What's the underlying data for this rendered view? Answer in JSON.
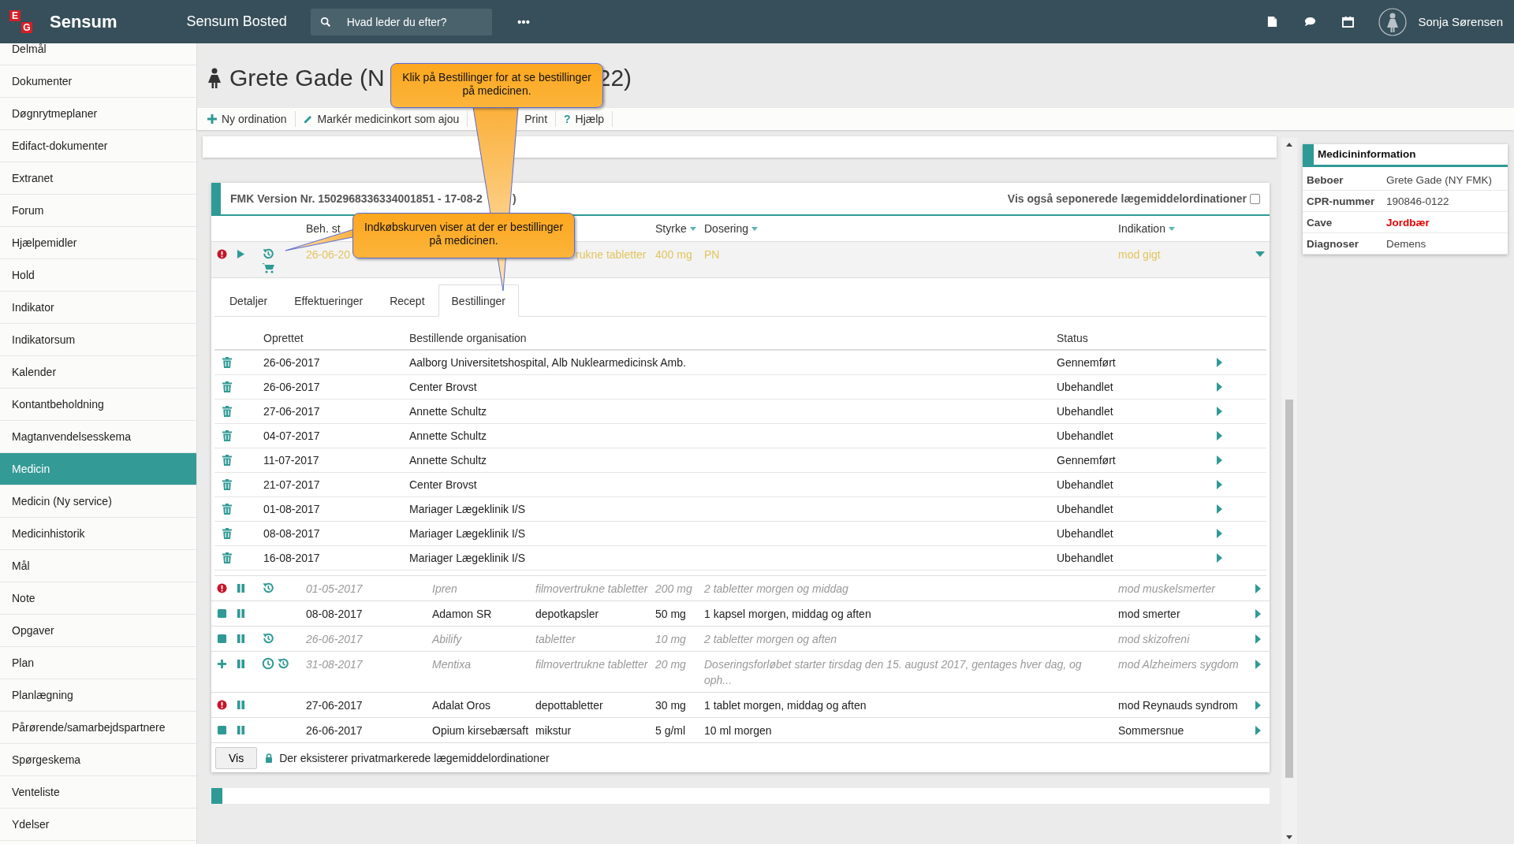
{
  "topbar": {
    "logo_letters": [
      "E",
      "G"
    ],
    "brand": "Sensum",
    "product": "Sensum Bosted",
    "search": {
      "placeholder": "Hvad leder du efter?"
    },
    "user": "Sonja Sørensen"
  },
  "sidebar": {
    "items": [
      {
        "label": "Delmål",
        "selected": false
      },
      {
        "label": "Dokumenter",
        "selected": false
      },
      {
        "label": "Døgnrytmeplaner",
        "selected": false
      },
      {
        "label": "Edifact-dokumenter",
        "selected": false
      },
      {
        "label": "Extranet",
        "selected": false
      },
      {
        "label": "Forum",
        "selected": false
      },
      {
        "label": "Hjælpemidler",
        "selected": false
      },
      {
        "label": "Hold",
        "selected": false
      },
      {
        "label": "Indikator",
        "selected": false
      },
      {
        "label": "Indikatorsum",
        "selected": false
      },
      {
        "label": "Kalender",
        "selected": false
      },
      {
        "label": "Kontantbeholdning",
        "selected": false
      },
      {
        "label": "Magtanvendelsesskema",
        "selected": false
      },
      {
        "label": "Medicin",
        "selected": true
      },
      {
        "label": "Medicin (Ny service)",
        "selected": false
      },
      {
        "label": "Medicinhistorik",
        "selected": false
      },
      {
        "label": "Mål",
        "selected": false
      },
      {
        "label": "Note",
        "selected": false
      },
      {
        "label": "Opgaver",
        "selected": false
      },
      {
        "label": "Plan",
        "selected": false
      },
      {
        "label": "Planlægning",
        "selected": false
      },
      {
        "label": "Pårørende/samarbejdspartnere",
        "selected": false
      },
      {
        "label": "Spørgeskema",
        "selected": false
      },
      {
        "label": "Venteliste",
        "selected": false
      },
      {
        "label": "Ydelser",
        "selected": false
      }
    ]
  },
  "title": {
    "left": "Grete Gade (N",
    "right": "22)"
  },
  "toolbar": [
    {
      "kind": "add",
      "label": "Ny ordination"
    },
    {
      "kind": "edit",
      "label": "Markér medicinkort som ajou"
    },
    {
      "kind": "plain",
      "label": "Print"
    },
    {
      "kind": "help",
      "icon_text": "?",
      "label": "Hjælp"
    }
  ],
  "fmk": {
    "version": "FMK Version Nr. 1502968336334001851 - 17-08-2",
    "version_end": ")",
    "show_discontinued": "Vis også seponerede lægemiddelordinationer",
    "checked": false
  },
  "columns": [
    {
      "label": "Beh. st",
      "sortable": false
    },
    {
      "label": "Styrke",
      "sortable": true
    },
    {
      "label": "Dosering",
      "sortable": true
    },
    {
      "label": "Indikation",
      "sortable": true
    }
  ],
  "medications": [
    {
      "icons": [
        {
          "kind": "alert"
        },
        {
          "kind": "play"
        },
        {
          "kind": "history"
        },
        {
          "kind": "cart"
        }
      ],
      "date": "26-06-20",
      "form": "rukne tabletter",
      "strength": "400 mg",
      "dosing": "PN",
      "indication": "mod gigt",
      "inactive": false,
      "selected": true,
      "expanded": true
    },
    {
      "icons": [
        {
          "kind": "alert"
        },
        {
          "kind": "pause"
        },
        {
          "kind": "history"
        }
      ],
      "date": "01-05-2017",
      "name": "Ipren",
      "form": "filmovertrukne tabletter",
      "strength": "200 mg",
      "dosing": "2 tabletter morgen og middag",
      "indication": "mod muskelsmerter",
      "inactive": true,
      "selected": false,
      "expanded": false
    },
    {
      "icons": [
        {
          "kind": "square"
        },
        {
          "kind": "pause"
        }
      ],
      "date": "08-08-2017",
      "name": "Adamon SR",
      "form": "depotkapsler",
      "strength": "50 mg",
      "dosing": "1 kapsel morgen, middag og aften",
      "indication": "mod smerter",
      "inactive": false,
      "selected": false,
      "expanded": false
    },
    {
      "icons": [
        {
          "kind": "square"
        },
        {
          "kind": "pause"
        },
        {
          "kind": "history"
        }
      ],
      "date": "26-06-2017",
      "name": "Abilify",
      "form": "tabletter",
      "strength": "10 mg",
      "dosing": "2 tabletter morgen og aften",
      "indication": "mod skizofreni",
      "inactive": true,
      "selected": false,
      "expanded": false
    },
    {
      "icons": [
        {
          "kind": "plus"
        },
        {
          "kind": "pause"
        },
        {
          "kind": "clock"
        },
        {
          "kind": "history"
        }
      ],
      "date": "31-08-2017",
      "name": "Mentixa",
      "form": "filmovertrukne tabletter",
      "strength": "20 mg",
      "dosing": "Doseringsforløbet starter tirsdag den 15. august 2017, gentages hver dag, og oph...",
      "indication": "mod Alzheimers sygdom",
      "inactive": true,
      "selected": false,
      "expanded": false
    },
    {
      "icons": [
        {
          "kind": "alert"
        },
        {
          "kind": "pause"
        }
      ],
      "date": "27-06-2017",
      "name": "Adalat Oros",
      "form": "depottabletter",
      "strength": "30 mg",
      "dosing": "1 tablet morgen, middag og aften",
      "indication": "mod Reynauds syndrom",
      "inactive": false,
      "selected": false,
      "expanded": false
    },
    {
      "icons": [
        {
          "kind": "square"
        },
        {
          "kind": "pause"
        }
      ],
      "date": "26-06-2017",
      "name": "Opium kirsebærsaft",
      "form": "mikstur",
      "strength": "5 g/ml",
      "dosing": "10 ml morgen",
      "indication": "Sommersnue",
      "inactive": false,
      "selected": false,
      "expanded": false
    }
  ],
  "detail_tabs": [
    {
      "label": "Detaljer",
      "selected": false
    },
    {
      "label": "Effektueringer",
      "selected": false
    },
    {
      "label": "Recept",
      "selected": false
    },
    {
      "label": "Bestillinger",
      "selected": true
    }
  ],
  "orders": {
    "columns": [
      "Oprettet",
      "Bestillende organisation",
      "Status"
    ],
    "rows": [
      {
        "created": "26-06-2017",
        "organisation": "Aalborg Universitetshospital, Alb Nuklearmedicinsk Amb.",
        "status": "Gennemført"
      },
      {
        "created": "26-06-2017",
        "organisation": "Center Brovst",
        "status": "Ubehandlet"
      },
      {
        "created": "27-06-2017",
        "organisation": "Annette Schultz",
        "status": "Ubehandlet"
      },
      {
        "created": "04-07-2017",
        "organisation": "Annette Schultz",
        "status": "Ubehandlet"
      },
      {
        "created": "11-07-2017",
        "organisation": "Annette Schultz",
        "status": "Gennemført"
      },
      {
        "created": "21-07-2017",
        "organisation": "Center Brovst",
        "status": "Ubehandlet"
      },
      {
        "created": "01-08-2017",
        "organisation": "Mariager Lægeklinik I/S",
        "status": "Ubehandlet"
      },
      {
        "created": "08-08-2017",
        "organisation": "Mariager Lægeklinik I/S",
        "status": "Ubehandlet"
      },
      {
        "created": "16-08-2017",
        "organisation": "Mariager Lægeklinik I/S",
        "status": "Ubehandlet"
      }
    ]
  },
  "footer": {
    "button": "Vis",
    "notice": "Der eksisterer privatmarkerede lægemiddelordinationer"
  },
  "medicine_info": {
    "title": "Medicininformation",
    "rows": [
      {
        "label": "Beboer",
        "value": "Grete Gade (NY FMK)",
        "warning": false
      },
      {
        "label": "CPR-nummer",
        "value": "190846-0122",
        "warning": false
      },
      {
        "label": "Cave",
        "value": "Jordbær",
        "warning": true
      },
      {
        "label": "Diagnoser",
        "value": "Demens",
        "warning": false
      }
    ]
  },
  "callouts": [
    {
      "text": "Klik på Bestillinger for at se bestillinger på medicinen."
    },
    {
      "text": "Indkøbskurven viser at der er bestillinger på medicinen."
    }
  ]
}
